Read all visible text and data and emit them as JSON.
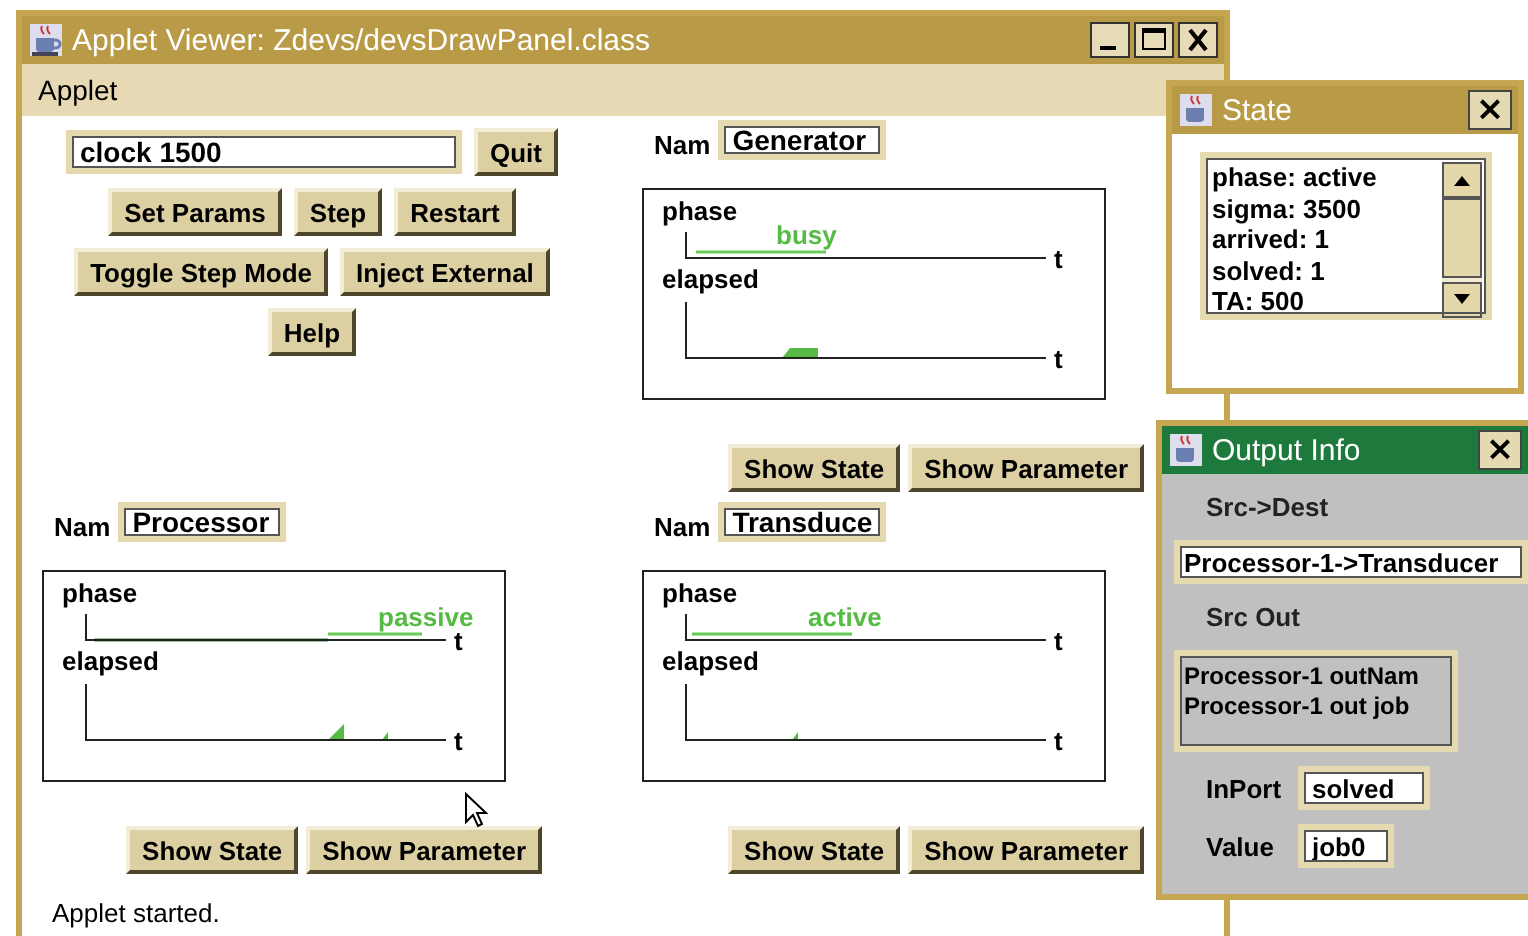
{
  "window": {
    "title": "Applet Viewer: Zdevs/devsDrawPanel.class"
  },
  "menu": [
    "Applet"
  ],
  "controls": {
    "command": "clock 1500",
    "quit": "Quit",
    "button_rows": [
      [
        "Set Params",
        "Step",
        "Restart"
      ],
      [
        "Toggle Step Mode",
        "Inject External"
      ],
      [
        "Help"
      ]
    ]
  },
  "models": [
    {
      "name_label": "Nam",
      "name": "Generator",
      "phase_label": "phase",
      "phase": "busy",
      "elapsed_label": "elapsed",
      "phase_axis_end": "t",
      "elapsed_axis_end": "t",
      "buttons": [
        "Show State",
        "Show Parameter"
      ]
    },
    {
      "name_label": "Nam",
      "name": "Processor",
      "phase_label": "phase",
      "phase": "passive",
      "elapsed_label": "elapsed",
      "phase_axis_end": "t",
      "elapsed_axis_end": "t",
      "buttons": [
        "Show State",
        "Show Parameter"
      ]
    },
    {
      "name_label": "Nam",
      "name": "Transduce",
      "phase_label": "phase",
      "phase": "active",
      "elapsed_label": "elapsed",
      "phase_axis_end": "t",
      "elapsed_axis_end": "t",
      "buttons": [
        "Show State",
        "Show Parameter"
      ]
    }
  ],
  "status": "Applet started.",
  "state_window": {
    "title": "State",
    "close": "×",
    "lines": [
      "phase: active",
      "sigma: 3500",
      "arrived: 1",
      "solved: 1",
      "TA: 500"
    ]
  },
  "output_window": {
    "title": "Output Info",
    "close": "×",
    "src_dest_label": "Src->Dest",
    "src_dest": "Processor-1->Transducer",
    "src_out_label": "Src Out",
    "src_out": [
      "Processor-1 outNam",
      "Processor-1 out job"
    ],
    "inport_label": "InPort",
    "inport": "solved",
    "value_label": "Value",
    "value": "job0"
  }
}
